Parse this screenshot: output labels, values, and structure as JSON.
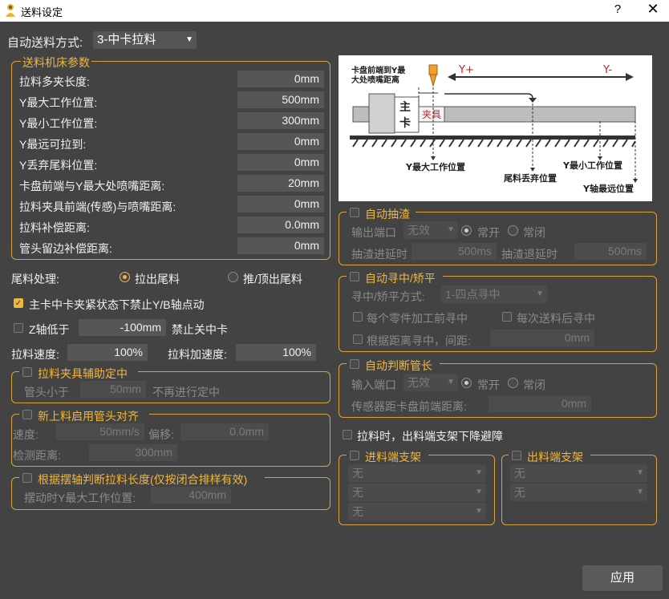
{
  "window": {
    "title": "送料设定",
    "help": "?",
    "close": "✕"
  },
  "mode": {
    "label": "自动送料方式:",
    "value": "3-中卡拉料"
  },
  "machine": {
    "legend": "送料机床参数",
    "rows": [
      {
        "label": "拉料多夹长度:",
        "value": "0mm"
      },
      {
        "label": "Y最大工作位置:",
        "value": "500mm"
      },
      {
        "label": "Y最小工作位置:",
        "value": "300mm"
      },
      {
        "label": "Y最远可拉到:",
        "value": "0mm"
      },
      {
        "label": "Y丢弃尾料位置:",
        "value": "0mm"
      },
      {
        "label": "卡盘前端与Y最大处喷嘴距离:",
        "value": "20mm"
      },
      {
        "label": "拉料夹具前端(传感)与喷嘴距离:",
        "value": "0mm"
      },
      {
        "label": "拉料补偿距离:",
        "value": "0.0mm"
      },
      {
        "label": "管头留边补偿距离:",
        "value": "0mm"
      }
    ]
  },
  "tail": {
    "label": "尾料处理:",
    "opt1": "拉出尾料",
    "opt2": "推/顶出尾料"
  },
  "lock_y": {
    "label": "主卡中卡夹紧状态下禁止Y/B轴点动"
  },
  "z_low": {
    "label": "Z轴低于",
    "value": "-100mm",
    "suffix": "禁止关中卡"
  },
  "speed": {
    "label": "拉料速度:",
    "value": "100%",
    "acc_label": "拉料加速度:",
    "acc_value": "100%"
  },
  "fixture": {
    "legend": "拉料夹具辅助定中",
    "pre": "管头小于",
    "value": "50mm",
    "post": "不再进行定中"
  },
  "align": {
    "legend": "新上料启用管头对齐",
    "speed_label": "速度:",
    "speed_value": "50mm/s",
    "offset_label": "偏移:",
    "offset_value": "0.0mm",
    "dist_label": "检测距离:",
    "dist_value": "300mm"
  },
  "swing": {
    "legend": "根据摆轴判断拉料长度(仅按闭合排样有效)",
    "label": "摆动时Y最大工作位置:",
    "value": "400mm"
  },
  "diagram": {
    "top_label_1": "卡盘前端到Y最",
    "top_label_2": "大处喷嘴距离",
    "y_plus": "Y+",
    "y_minus": "Y-",
    "chuck_1": "主",
    "chuck_2": "卡",
    "fixture": "夹具",
    "ymax": "Y最大工作位置",
    "tail_pos": "尾料丢弃位置",
    "ymin": "Y最小工作位置",
    "yfar": "Y轴最远位置"
  },
  "slag": {
    "legend": "自动抽渣",
    "port_label": "输出端口",
    "port_value": "无效",
    "on": "常开",
    "off": "常闭",
    "in_delay_label": "抽渣进延时",
    "in_delay": "500ms",
    "out_delay_label": "抽渣退延时",
    "out_delay": "500ms"
  },
  "center": {
    "legend": "自动寻中/矫平",
    "method_label": "寻中/矫平方式:",
    "method_value": "1-四点寻中",
    "each_part": "每个零件加工前寻中",
    "each_feed": "每次送料后寻中",
    "by_dist": "根据距离寻中，间距:",
    "dist_value": "0mm"
  },
  "tube_end": {
    "legend": "自动判断管长",
    "port_label": "输入端口",
    "port_value": "无效",
    "on": "常开",
    "off": "常闭",
    "sensor_label": "传感器距卡盘前端距离:",
    "sensor_value": "0mm"
  },
  "lower_support": {
    "label": "拉料时，出料端支架下降避障"
  },
  "in_support": {
    "legend": "进料端支架",
    "items": [
      "无",
      "无",
      "无"
    ]
  },
  "out_support": {
    "legend": "出料端支架",
    "items": [
      "无",
      "无"
    ]
  },
  "apply": {
    "label": "应用"
  }
}
